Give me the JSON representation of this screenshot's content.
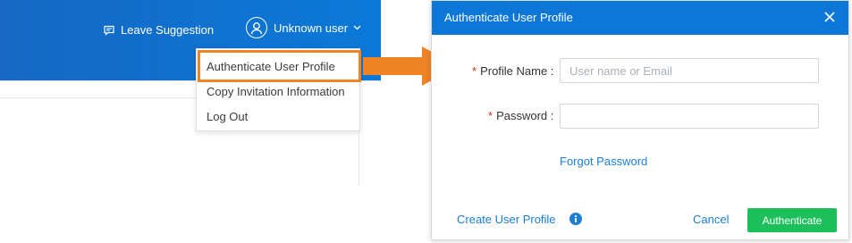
{
  "topbar": {
    "suggestion_label": "Leave Suggestion",
    "user_label": "Unknown user"
  },
  "dropdown": {
    "items": [
      {
        "label": "Authenticate User Profile"
      },
      {
        "label": "Copy Invitation Information"
      },
      {
        "label": "Log Out"
      }
    ]
  },
  "dialog": {
    "title": "Authenticate User Profile",
    "profile_label": "Profile Name :",
    "profile_placeholder": "User name or Email",
    "profile_value": "",
    "password_label": "Password :",
    "password_value": "",
    "required_mark": "*",
    "forgot_label": "Forgot Password",
    "create_label": "Create User Profile",
    "cancel_label": "Cancel",
    "authenticate_label": "Authenticate"
  },
  "colors": {
    "header_blue": "#0d77d7",
    "highlight_orange": "#f08424",
    "link_blue": "#1a7fd6",
    "button_green": "#1dbf5b",
    "required_red": "#e0281e"
  },
  "icons": [
    "comment-icon",
    "user-avatar-icon",
    "chevron-down-icon",
    "close-icon",
    "info-icon",
    "arrow-icon"
  ]
}
